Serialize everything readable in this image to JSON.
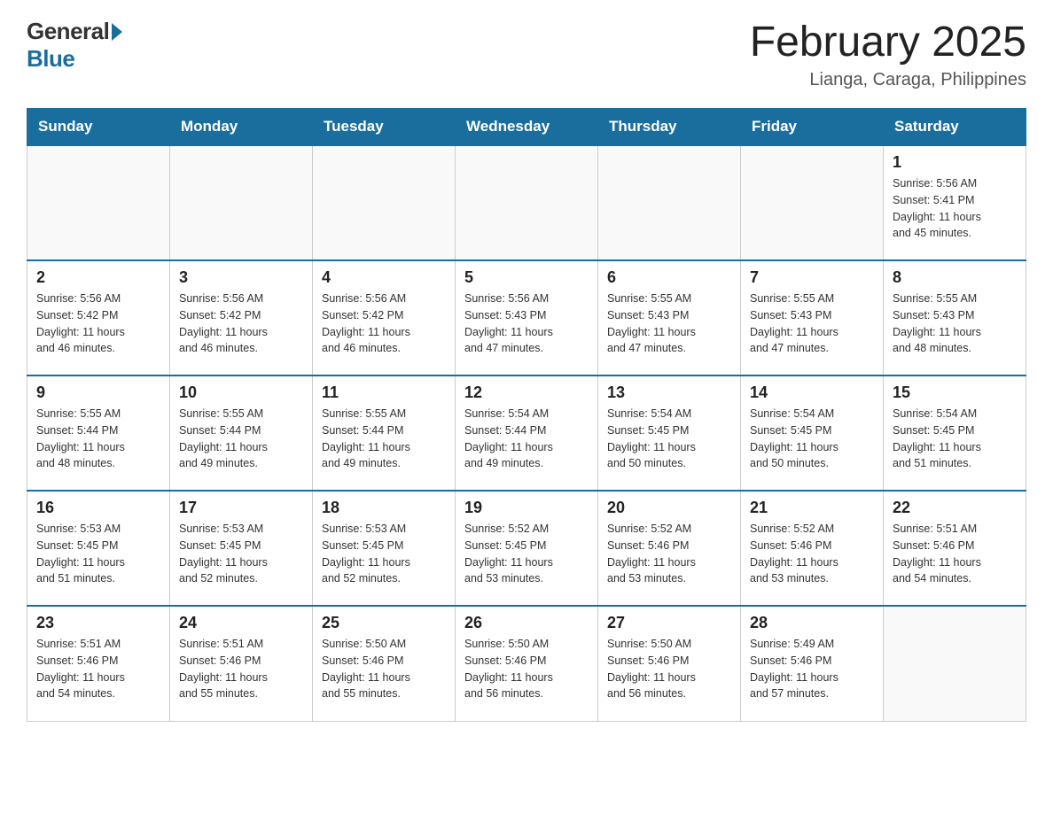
{
  "header": {
    "month_year": "February 2025",
    "location": "Lianga, Caraga, Philippines"
  },
  "logo": {
    "general": "General",
    "blue": "Blue"
  },
  "days_of_week": [
    "Sunday",
    "Monday",
    "Tuesday",
    "Wednesday",
    "Thursday",
    "Friday",
    "Saturday"
  ],
  "weeks": [
    [
      {
        "day": "",
        "info": ""
      },
      {
        "day": "",
        "info": ""
      },
      {
        "day": "",
        "info": ""
      },
      {
        "day": "",
        "info": ""
      },
      {
        "day": "",
        "info": ""
      },
      {
        "day": "",
        "info": ""
      },
      {
        "day": "1",
        "info": "Sunrise: 5:56 AM\nSunset: 5:41 PM\nDaylight: 11 hours\nand 45 minutes."
      }
    ],
    [
      {
        "day": "2",
        "info": "Sunrise: 5:56 AM\nSunset: 5:42 PM\nDaylight: 11 hours\nand 46 minutes."
      },
      {
        "day": "3",
        "info": "Sunrise: 5:56 AM\nSunset: 5:42 PM\nDaylight: 11 hours\nand 46 minutes."
      },
      {
        "day": "4",
        "info": "Sunrise: 5:56 AM\nSunset: 5:42 PM\nDaylight: 11 hours\nand 46 minutes."
      },
      {
        "day": "5",
        "info": "Sunrise: 5:56 AM\nSunset: 5:43 PM\nDaylight: 11 hours\nand 47 minutes."
      },
      {
        "day": "6",
        "info": "Sunrise: 5:55 AM\nSunset: 5:43 PM\nDaylight: 11 hours\nand 47 minutes."
      },
      {
        "day": "7",
        "info": "Sunrise: 5:55 AM\nSunset: 5:43 PM\nDaylight: 11 hours\nand 47 minutes."
      },
      {
        "day": "8",
        "info": "Sunrise: 5:55 AM\nSunset: 5:43 PM\nDaylight: 11 hours\nand 48 minutes."
      }
    ],
    [
      {
        "day": "9",
        "info": "Sunrise: 5:55 AM\nSunset: 5:44 PM\nDaylight: 11 hours\nand 48 minutes."
      },
      {
        "day": "10",
        "info": "Sunrise: 5:55 AM\nSunset: 5:44 PM\nDaylight: 11 hours\nand 49 minutes."
      },
      {
        "day": "11",
        "info": "Sunrise: 5:55 AM\nSunset: 5:44 PM\nDaylight: 11 hours\nand 49 minutes."
      },
      {
        "day": "12",
        "info": "Sunrise: 5:54 AM\nSunset: 5:44 PM\nDaylight: 11 hours\nand 49 minutes."
      },
      {
        "day": "13",
        "info": "Sunrise: 5:54 AM\nSunset: 5:45 PM\nDaylight: 11 hours\nand 50 minutes."
      },
      {
        "day": "14",
        "info": "Sunrise: 5:54 AM\nSunset: 5:45 PM\nDaylight: 11 hours\nand 50 minutes."
      },
      {
        "day": "15",
        "info": "Sunrise: 5:54 AM\nSunset: 5:45 PM\nDaylight: 11 hours\nand 51 minutes."
      }
    ],
    [
      {
        "day": "16",
        "info": "Sunrise: 5:53 AM\nSunset: 5:45 PM\nDaylight: 11 hours\nand 51 minutes."
      },
      {
        "day": "17",
        "info": "Sunrise: 5:53 AM\nSunset: 5:45 PM\nDaylight: 11 hours\nand 52 minutes."
      },
      {
        "day": "18",
        "info": "Sunrise: 5:53 AM\nSunset: 5:45 PM\nDaylight: 11 hours\nand 52 minutes."
      },
      {
        "day": "19",
        "info": "Sunrise: 5:52 AM\nSunset: 5:45 PM\nDaylight: 11 hours\nand 53 minutes."
      },
      {
        "day": "20",
        "info": "Sunrise: 5:52 AM\nSunset: 5:46 PM\nDaylight: 11 hours\nand 53 minutes."
      },
      {
        "day": "21",
        "info": "Sunrise: 5:52 AM\nSunset: 5:46 PM\nDaylight: 11 hours\nand 53 minutes."
      },
      {
        "day": "22",
        "info": "Sunrise: 5:51 AM\nSunset: 5:46 PM\nDaylight: 11 hours\nand 54 minutes."
      }
    ],
    [
      {
        "day": "23",
        "info": "Sunrise: 5:51 AM\nSunset: 5:46 PM\nDaylight: 11 hours\nand 54 minutes."
      },
      {
        "day": "24",
        "info": "Sunrise: 5:51 AM\nSunset: 5:46 PM\nDaylight: 11 hours\nand 55 minutes."
      },
      {
        "day": "25",
        "info": "Sunrise: 5:50 AM\nSunset: 5:46 PM\nDaylight: 11 hours\nand 55 minutes."
      },
      {
        "day": "26",
        "info": "Sunrise: 5:50 AM\nSunset: 5:46 PM\nDaylight: 11 hours\nand 56 minutes."
      },
      {
        "day": "27",
        "info": "Sunrise: 5:50 AM\nSunset: 5:46 PM\nDaylight: 11 hours\nand 56 minutes."
      },
      {
        "day": "28",
        "info": "Sunrise: 5:49 AM\nSunset: 5:46 PM\nDaylight: 11 hours\nand 57 minutes."
      },
      {
        "day": "",
        "info": ""
      }
    ]
  ]
}
